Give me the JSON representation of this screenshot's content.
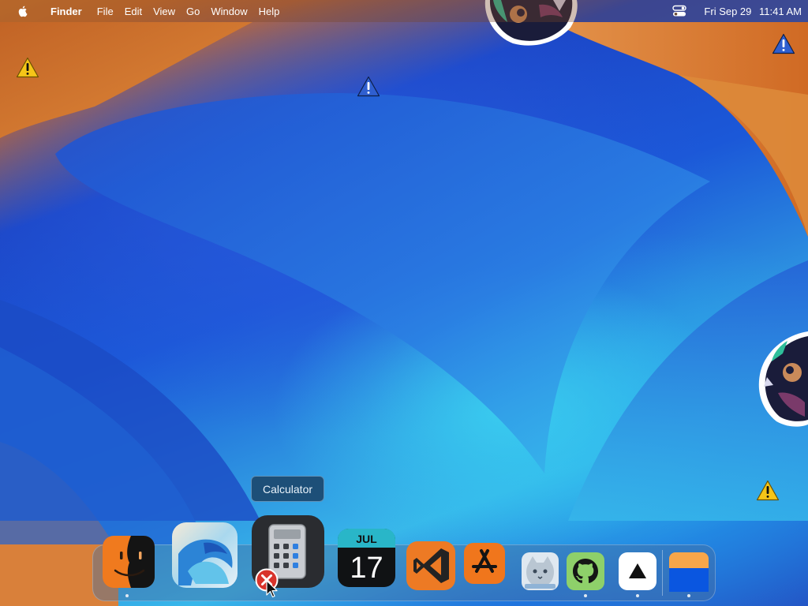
{
  "menubar": {
    "app_name": "Finder",
    "items": [
      "File",
      "Edit",
      "View",
      "Go",
      "Window",
      "Help"
    ],
    "date": "Fri Sep 29",
    "time": "11:41 AM"
  },
  "tooltip": {
    "label": "Calculator"
  },
  "dock": {
    "items": [
      {
        "name": "Finder",
        "icon": "finder-icon",
        "running": true
      },
      {
        "name": "macOS Sequoia",
        "icon": "wallpaper-installer-icon",
        "running": false
      },
      {
        "name": "Calculator",
        "icon": "calculator-icon",
        "running": false
      },
      {
        "name": "Calendar",
        "icon": "calendar-icon",
        "running": false,
        "month": "JUL",
        "day": "17"
      },
      {
        "name": "Visual Studio Code",
        "icon": "vscode-icon",
        "running": false
      },
      {
        "name": "App Store",
        "icon": "app-store-icon",
        "running": false
      },
      {
        "name": "Preview",
        "icon": "cat-photo-icon",
        "running": false
      },
      {
        "name": "GitHub Desktop",
        "icon": "github-icon",
        "running": true
      },
      {
        "name": "Vercel",
        "icon": "triangle-icon",
        "running": true
      },
      {
        "name": "Downloads",
        "icon": "folder-stack-icon",
        "running": true
      }
    ]
  },
  "colors": {
    "menubar_text": "#ffffff",
    "tooltip_bg": "#1d4f78",
    "accent_orange": "#f07a1e",
    "warning_yellow": "#f5c518",
    "warning_blue": "#2f5fd0"
  }
}
